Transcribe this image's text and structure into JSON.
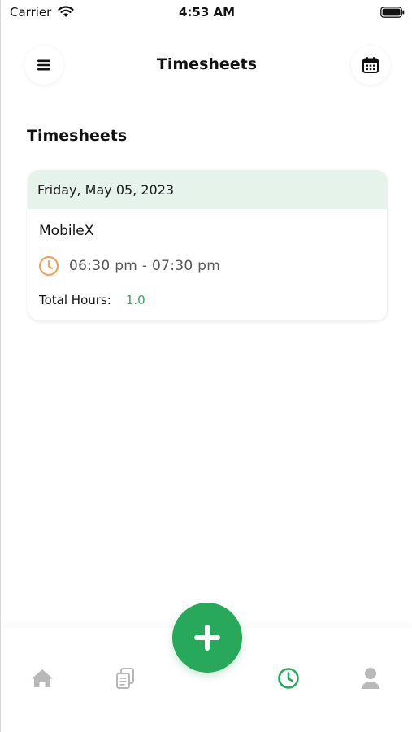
{
  "status_bar": {
    "carrier": "Carrier",
    "time": "4:53 AM"
  },
  "header": {
    "title": "Timesheets",
    "menu_icon": "hamburger-menu-icon",
    "calendar_icon": "calendar-icon"
  },
  "section": {
    "title": "Timesheets"
  },
  "timesheets": [
    {
      "date": "Friday, May 05, 2023",
      "project": "MobileX",
      "time_range": "06:30 pm - 07:30 pm",
      "total_hours_label": "Total Hours:",
      "total_hours": "1.0"
    }
  ],
  "bottom_nav": {
    "items": [
      {
        "icon": "home-icon",
        "active": false
      },
      {
        "icon": "documents-icon",
        "active": false
      },
      {
        "icon": "clock-icon",
        "active": true
      },
      {
        "icon": "profile-icon",
        "active": false
      }
    ],
    "fab_icon": "plus-icon"
  },
  "colors": {
    "accent": "#28a85a",
    "card_header_bg": "#e5f3ea",
    "clock_icon": "#f0a35a",
    "nav_inactive": "#b8b8b8"
  }
}
